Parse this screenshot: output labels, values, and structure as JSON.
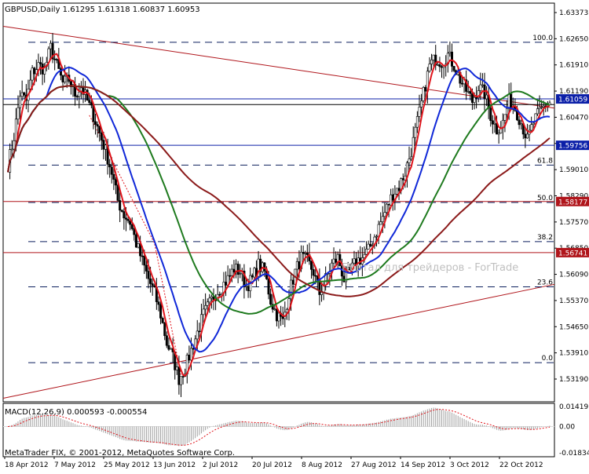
{
  "window": {
    "symbol_info": "GBPUSD,Daily  1.61295 1.61318 1.60837 1.60953",
    "watermark": "Портал для трейдеров - ForTrade",
    "copyright": "MetaTrader FIX, © 2001-2012, MetaQuotes Software Corp."
  },
  "chart_data": [
    {
      "type": "candlestick",
      "title": "GBPUSD,Daily",
      "ohlc_last": {
        "open": 1.61295,
        "high": 1.61318,
        "low": 1.60837,
        "close": 1.60953
      },
      "ylim": [
        1.5255,
        1.6375
      ],
      "y_ticks": [
        "1.63373",
        "1.62650",
        "1.61910",
        "1.61190",
        "1.60470",
        "1.59756",
        "1.59010",
        "1.58290",
        "1.57570",
        "1.56850",
        "1.56090",
        "1.55370",
        "1.54650",
        "1.53910",
        "1.53190"
      ],
      "x_ticks": [
        "18 Apr 2012",
        "7 May 2012",
        "25 May 2012",
        "13 Jun 2012",
        "2 Jul 2012",
        "20 Jul 2012",
        "8 Aug 2012",
        "27 Aug 2012",
        "14 Sep 2012",
        "3 Oct 2012",
        "22 Oct 2012"
      ],
      "price_labels": [
        {
          "text": "1.61059",
          "value": 1.61059,
          "color": "#0b1fa8"
        },
        {
          "text": "1.59756",
          "value": 1.59756,
          "color": "#0b1fa8"
        },
        {
          "text": "1.58177",
          "value": 1.58177,
          "color": "#b0151b"
        },
        {
          "text": "1.56741",
          "value": 1.56741,
          "color": "#b0151b"
        }
      ],
      "fibonacci": [
        {
          "label": "100.0",
          "value": 1.6265
        },
        {
          "label": "61.8",
          "value": 1.592
        },
        {
          "label": "50.0",
          "value": 1.5815
        },
        {
          "label": "38.2",
          "value": 1.5705
        },
        {
          "label": "23.6",
          "value": 1.5578
        },
        {
          "label": "0.0",
          "value": 1.5365
        }
      ],
      "moving_averages": [
        {
          "color": "#e0141b",
          "period_hint": "fast"
        },
        {
          "color": "#1028d8",
          "period_hint": "medium"
        },
        {
          "color": "#1e7a1e",
          "period_hint": "slow"
        },
        {
          "color": "#8b1a1a",
          "period_hint": "very slow"
        }
      ],
      "close_path": [
        [
          0,
          1.592
        ],
        [
          3,
          1.6
        ],
        [
          6,
          1.612
        ],
        [
          9,
          1.61
        ],
        [
          12,
          1.618
        ],
        [
          15,
          1.62
        ],
        [
          18,
          1.619
        ],
        [
          21,
          1.625
        ],
        [
          24,
          1.62
        ],
        [
          27,
          1.615
        ],
        [
          30,
          1.616
        ],
        [
          33,
          1.612
        ],
        [
          36,
          1.614
        ],
        [
          39,
          1.61
        ],
        [
          42,
          1.606
        ],
        [
          45,
          1.601
        ],
        [
          48,
          1.596
        ],
        [
          51,
          1.59
        ],
        [
          54,
          1.582
        ],
        [
          57,
          1.578
        ],
        [
          60,
          1.576
        ],
        [
          63,
          1.57
        ],
        [
          66,
          1.565
        ],
        [
          69,
          1.56
        ],
        [
          72,
          1.556
        ],
        [
          75,
          1.55
        ],
        [
          78,
          1.542
        ],
        [
          81,
          1.538
        ],
        [
          84,
          1.532
        ],
        [
          87,
          1.535
        ],
        [
          90,
          1.54
        ],
        [
          93,
          1.545
        ],
        [
          96,
          1.55
        ],
        [
          99,
          1.553
        ],
        [
          102,
          1.556
        ],
        [
          105,
          1.558
        ],
        [
          108,
          1.56
        ],
        [
          111,
          1.563
        ],
        [
          114,
          1.562
        ],
        [
          117,
          1.558
        ],
        [
          120,
          1.56
        ],
        [
          123,
          1.564
        ],
        [
          126,
          1.562
        ],
        [
          129,
          1.554
        ],
        [
          132,
          1.55
        ],
        [
          135,
          1.548
        ],
        [
          138,
          1.556
        ],
        [
          141,
          1.562
        ],
        [
          144,
          1.566
        ],
        [
          147,
          1.565
        ],
        [
          150,
          1.562
        ],
        [
          153,
          1.556
        ],
        [
          156,
          1.56
        ],
        [
          159,
          1.564
        ],
        [
          162,
          1.566
        ],
        [
          165,
          1.56
        ],
        [
          168,
          1.562
        ],
        [
          171,
          1.565
        ],
        [
          174,
          1.566
        ],
        [
          177,
          1.568
        ],
        [
          180,
          1.572
        ],
        [
          183,
          1.576
        ],
        [
          186,
          1.58
        ],
        [
          189,
          1.584
        ],
        [
          192,
          1.586
        ],
        [
          195,
          1.59
        ],
        [
          198,
          1.596
        ],
        [
          201,
          1.604
        ],
        [
          204,
          1.612
        ],
        [
          207,
          1.62
        ],
        [
          210,
          1.622
        ],
        [
          213,
          1.621
        ],
        [
          216,
          1.623
        ],
        [
          219,
          1.62
        ],
        [
          222,
          1.616
        ],
        [
          225,
          1.613
        ],
        [
          228,
          1.61
        ],
        [
          231,
          1.614
        ],
        [
          234,
          1.612
        ],
        [
          237,
          1.606
        ],
        [
          240,
          1.602
        ],
        [
          243,
          1.604
        ],
        [
          246,
          1.61
        ],
        [
          249,
          1.608
        ],
        [
          252,
          1.604
        ],
        [
          255,
          1.599
        ],
        [
          258,
          1.604
        ],
        [
          261,
          1.607
        ],
        [
          264,
          1.609
        ],
        [
          266,
          1.6095
        ]
      ],
      "indicator": {
        "label": "MACD(12,26,9) 0.000593 -0.000554",
        "y_ticks": [
          "0.014191",
          "0.00",
          "-0.01834"
        ],
        "ylim": [
          -0.0185,
          0.0142
        ]
      }
    }
  ]
}
